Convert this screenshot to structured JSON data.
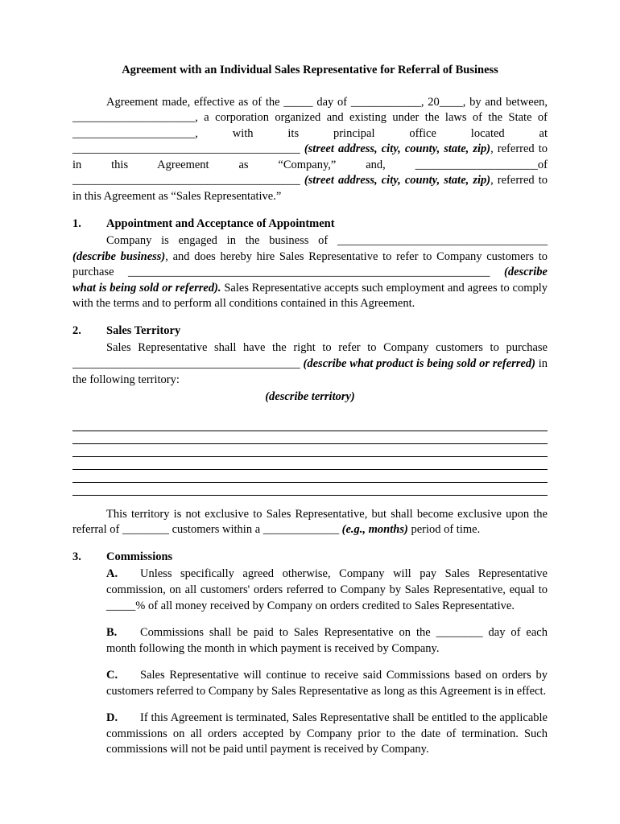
{
  "title": "Agreement with an Individual Sales Representative for Referral of Business",
  "preamble": {
    "t1": "Agreement made, effective as of the _____ day of ____________, 20____, by and between, _____________________, a corporation organized and existing under the laws of the State of _____________________, with its principal office located at _______________________________________ ",
    "addr1": "(street address, city, county, state, zip)",
    "t2": ", referred to in this Agreement as “Company,” and, _____________________of _______________________________________ ",
    "addr2": "(street address, city, county, state, zip)",
    "t3": ", referred to in this Agreement as “Sales Representative.”"
  },
  "s1": {
    "num": "1.",
    "title": "Appointment and Acceptance of Appointment",
    "t1": "Company is engaged in the business of ____________________________________ ",
    "t1b": "(describe business)",
    "t2": ", and does hereby hire Sales Representative to refer to Company customers to purchase ______________________________________________________________ ",
    "t2b": "(describe what is being sold or referred).",
    "t3": " Sales Representative accepts such employment and agrees to comply with the terms and to perform all conditions contained in this Agreement."
  },
  "s2": {
    "num": "2.",
    "title": "Sales Territory",
    "t1": "Sales Representative shall have the right to refer to Company customers to purchase _______________________________________ ",
    "t1b": "(describe what product is being sold or referred)",
    "t2": " in the following territory:",
    "center": "(describe territory)",
    "t3a": "This territory is not exclusive to Sales Representative, but shall become exclusive upon the referral of ________ customers within a _____________ ",
    "t3b": "(e.g., months)",
    "t3c": " period of time."
  },
  "s3": {
    "num": "3.",
    "title": "Commissions",
    "A": {
      "lbl": "A.",
      "txt": "Unless specifically agreed otherwise, Company will pay Sales Representative commission, on all customers' orders referred to Company by Sales Representative, equal to _____% of all money received by Company on orders credited to Sales Representative."
    },
    "B": {
      "lbl": "B.",
      "txt": "Commissions shall be paid to Sales Representative on the ________ day of each month following the month in which payment is received by Company."
    },
    "C": {
      "lbl": "C.",
      "txt": "Sales Representative will continue to receive said Commissions based on orders by customers referred to Company by Sales Representative as long as this Agreement is in effect."
    },
    "D": {
      "lbl": "D.",
      "txt": "If this Agreement is terminated, Sales Representative shall be entitled to the applicable commissions on all orders accepted by Company prior to the date of termination. Such commissions will not be paid until payment is received by Company."
    }
  }
}
